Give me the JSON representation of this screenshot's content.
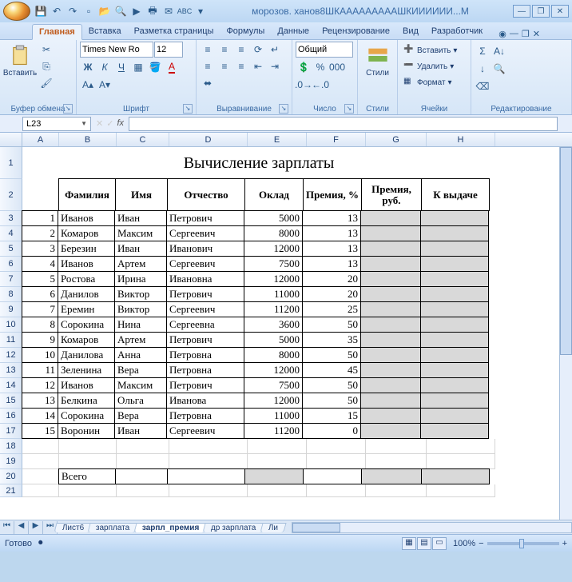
{
  "title": "морозов. ханов8ШКАААААААААШКИИИИИИ...M",
  "qat_icons": [
    "save-icon",
    "undo-icon",
    "redo-icon",
    "new-icon",
    "open-icon",
    "print-preview-icon",
    "quick-print-icon",
    "spellcheck-icon",
    "email-icon",
    "sort-asc-icon",
    "sort-desc-icon"
  ],
  "tabs": [
    "Главная",
    "Вставка",
    "Разметка страницы",
    "Формулы",
    "Данные",
    "Рецензирование",
    "Вид",
    "Разработчик"
  ],
  "active_tab": "Главная",
  "groups": {
    "clipboard": {
      "label": "Буфер обмена",
      "paste": "Вставить"
    },
    "font": {
      "label": "Шрифт",
      "name": "Times New Ro",
      "size": "12"
    },
    "align": {
      "label": "Выравнивание"
    },
    "number": {
      "label": "Число",
      "format": "Общий"
    },
    "styles": {
      "label": "Стили",
      "btn": "Стили"
    },
    "cells": {
      "label": "Ячейки",
      "insert": "Вставить",
      "delete": "Удалить",
      "format": "Формат"
    },
    "edit": {
      "label": "Редактирование"
    }
  },
  "namebox": "L23",
  "fx": "",
  "columns": [
    "A",
    "B",
    "C",
    "D",
    "E",
    "F",
    "G",
    "H"
  ],
  "sheet_title": "Вычисление зарплаты",
  "headers": [
    "",
    "Фамилия",
    "Имя",
    "Отчество",
    "Оклад",
    "Премия, %",
    "Премия, руб.",
    "К выдаче"
  ],
  "data_rows": [
    {
      "n": 1,
      "f": "Иванов",
      "i": "Иван",
      "o": "Петрович",
      "ok": 5000,
      "p": 13
    },
    {
      "n": 2,
      "f": "Комаров",
      "i": "Максим",
      "o": "Сергеевич",
      "ok": 8000,
      "p": 13
    },
    {
      "n": 3,
      "f": "Березин",
      "i": "Иван",
      "o": "Иванович",
      "ok": 12000,
      "p": 13
    },
    {
      "n": 4,
      "f": "Иванов",
      "i": "Артем",
      "o": "Сергеевич",
      "ok": 7500,
      "p": 13
    },
    {
      "n": 5,
      "f": "Ростова",
      "i": "Ирина",
      "o": "Ивановна",
      "ok": 12000,
      "p": 20
    },
    {
      "n": 6,
      "f": "Данилов",
      "i": "Виктор",
      "o": "Петрович",
      "ok": 11000,
      "p": 20
    },
    {
      "n": 7,
      "f": "Еремин",
      "i": "Виктор",
      "o": "Сергеевич",
      "ok": 11200,
      "p": 25
    },
    {
      "n": 8,
      "f": "Сорокина",
      "i": "Нина",
      "o": "Сергеевна",
      "ok": 3600,
      "p": 50
    },
    {
      "n": 9,
      "f": "Комаров",
      "i": "Артем",
      "o": "Петрович",
      "ok": 5000,
      "p": 35
    },
    {
      "n": 10,
      "f": "Данилова",
      "i": "Анна",
      "o": "Петровна",
      "ok": 8000,
      "p": 50
    },
    {
      "n": 11,
      "f": "Зеленина",
      "i": "Вера",
      "o": "Петровна",
      "ok": 12000,
      "p": 45
    },
    {
      "n": 12,
      "f": "Иванов",
      "i": "Максим",
      "o": "Петрович",
      "ok": 7500,
      "p": 50
    },
    {
      "n": 13,
      "f": "Белкина",
      "i": "Ольга",
      "o": "Иванова",
      "ok": 12000,
      "p": 50
    },
    {
      "n": 14,
      "f": "Сорокина",
      "i": "Вера",
      "o": "Петровна",
      "ok": 11000,
      "p": 15
    },
    {
      "n": 15,
      "f": "Воронин",
      "i": "Иван",
      "o": "Сергеевич",
      "ok": 11200,
      "p": 0
    }
  ],
  "total_label": "Всего",
  "sheets": [
    "Лист6",
    "зарплата",
    "зарпл_премия",
    "др зарплата",
    "Ли"
  ],
  "active_sheet": "зарпл_премия",
  "status": "Готово",
  "zoom": "100%"
}
